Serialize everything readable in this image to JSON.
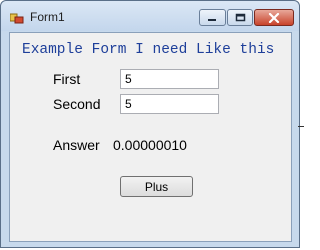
{
  "window": {
    "title": "Form1",
    "icon": "windows-forms-icon",
    "controls": [
      "minimize-icon",
      "maximize-icon",
      "close-icon"
    ]
  },
  "form": {
    "heading": "Example Form I need Like this",
    "first_label": "First",
    "first_value": "5",
    "second_label": "Second",
    "second_value": "5",
    "answer_label": "Answer",
    "answer_value": "0.00000010",
    "plus_label": "Plus"
  },
  "colors": {
    "heading_text": "#1e3f9a",
    "form_background": "#f0f0f0",
    "close_button": "#c8432b"
  }
}
